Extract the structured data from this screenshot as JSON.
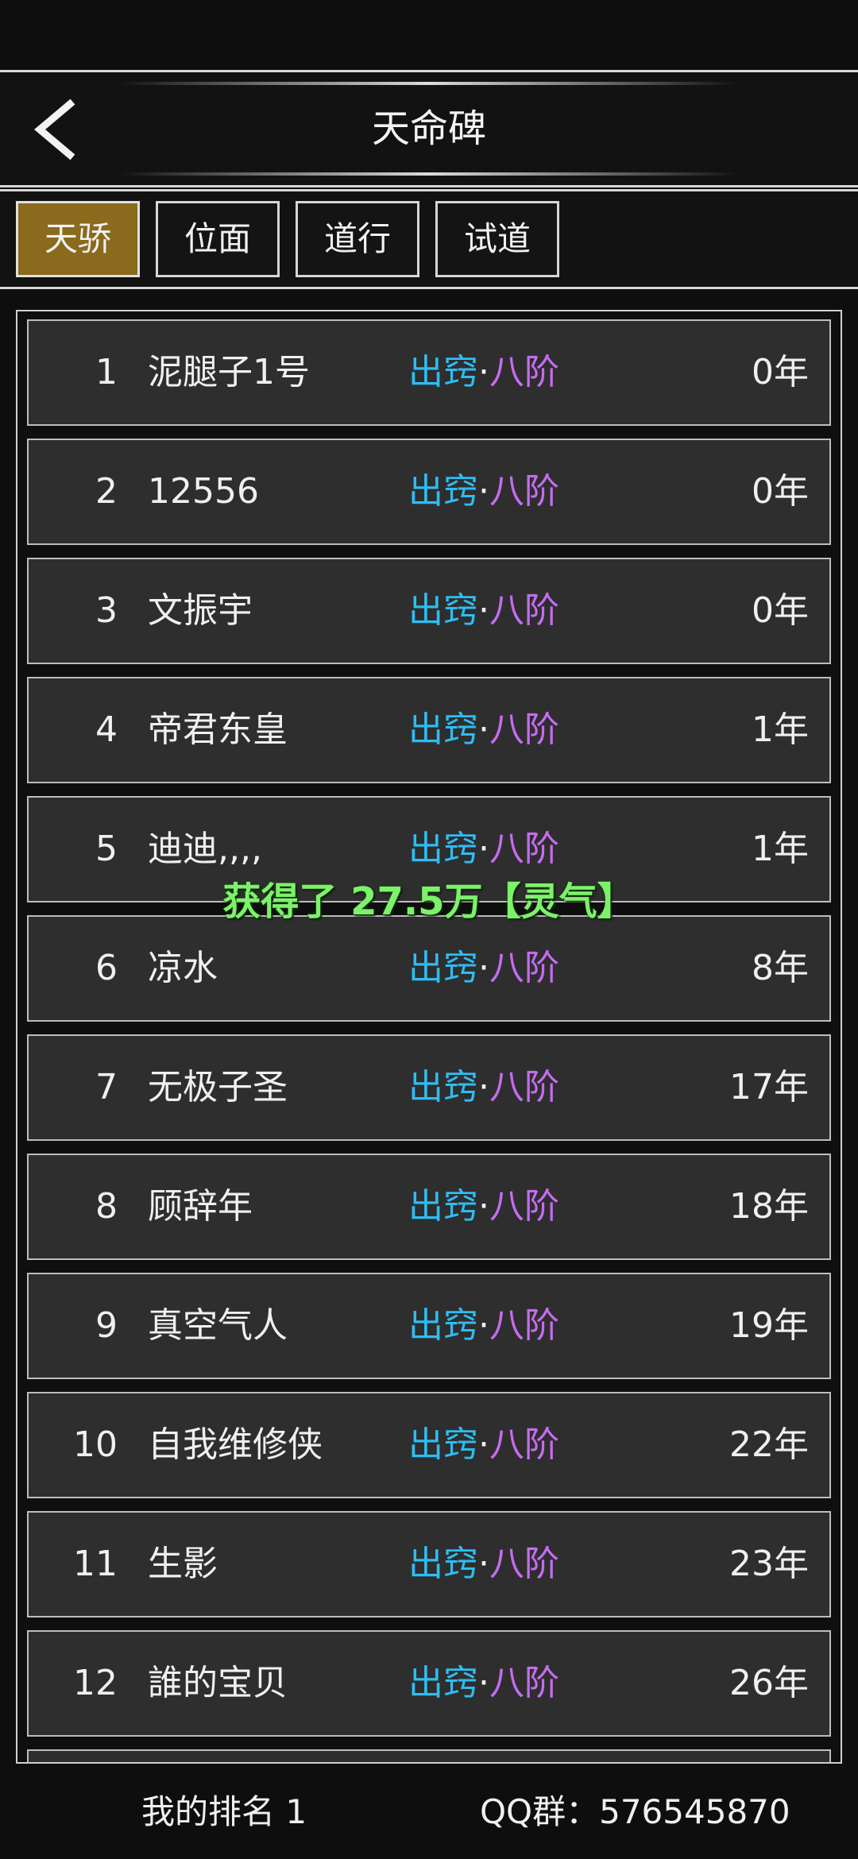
{
  "header": {
    "title": "天命碑"
  },
  "tabs": [
    {
      "label": "天骄",
      "active": true
    },
    {
      "label": "位面",
      "active": false
    },
    {
      "label": "道行",
      "active": false
    },
    {
      "label": "试道",
      "active": false
    }
  ],
  "rankings": [
    {
      "rank": "1",
      "name": "泥腿子1号",
      "realm_a": "出窍",
      "sep": "·",
      "realm_b": "八阶",
      "years": "0年"
    },
    {
      "rank": "2",
      "name": "12556",
      "realm_a": "出窍",
      "sep": "·",
      "realm_b": "八阶",
      "years": "0年"
    },
    {
      "rank": "3",
      "name": "文振宇",
      "realm_a": "出窍",
      "sep": "·",
      "realm_b": "八阶",
      "years": "0年"
    },
    {
      "rank": "4",
      "name": "帝君东皇",
      "realm_a": "出窍",
      "sep": "·",
      "realm_b": "八阶",
      "years": "1年"
    },
    {
      "rank": "5",
      "name": "迪迪,,,,",
      "realm_a": "出窍",
      "sep": "·",
      "realm_b": "八阶",
      "years": "1年"
    },
    {
      "rank": "6",
      "name": "凉水",
      "realm_a": "出窍",
      "sep": "·",
      "realm_b": "八阶",
      "years": "8年"
    },
    {
      "rank": "7",
      "name": "无极子圣",
      "realm_a": "出窍",
      "sep": "·",
      "realm_b": "八阶",
      "years": "17年"
    },
    {
      "rank": "8",
      "name": "顾辞年",
      "realm_a": "出窍",
      "sep": "·",
      "realm_b": "八阶",
      "years": "18年"
    },
    {
      "rank": "9",
      "name": "真空气人",
      "realm_a": "出窍",
      "sep": "·",
      "realm_b": "八阶",
      "years": "19年"
    },
    {
      "rank": "10",
      "name": "自我维修侠",
      "realm_a": "出窍",
      "sep": "·",
      "realm_b": "八阶",
      "years": "22年"
    },
    {
      "rank": "11",
      "name": "生影",
      "realm_a": "出窍",
      "sep": "·",
      "realm_b": "八阶",
      "years": "23年"
    },
    {
      "rank": "12",
      "name": "誰的宝贝",
      "realm_a": "出窍",
      "sep": "·",
      "realm_b": "八阶",
      "years": "26年"
    }
  ],
  "toast": "获得了 27.5万【灵气】",
  "footer": {
    "my_rank": "我的排名 1",
    "qq_group": "QQ群：576545870"
  },
  "colors": {
    "realm_primary": "#2ebdf2",
    "realm_secondary": "#c56cf0",
    "active_tab": "#8a6a1c",
    "toast": "#7cf26a"
  },
  "icons": {
    "back": "chevron-left-icon"
  }
}
